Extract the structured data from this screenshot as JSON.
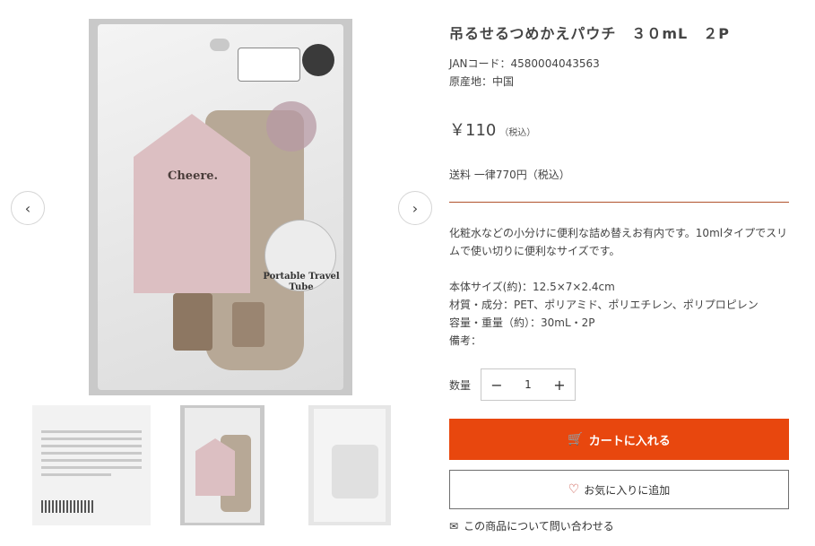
{
  "product": {
    "title": "吊るせるつめかえパウチ　３０mL　２P",
    "jan": "JANコード：4580004043563",
    "origin": "原産地：中国",
    "price": "￥110",
    "price_tax": "（税込）",
    "shipping": "送料 一律770円（税込）",
    "description": "化粧水などの小分けに便利な詰め替えお有内です。10mlタイプでスリムで使い切りに便利なサイズです。",
    "specs": [
      "本体サイズ(約)：12.5×7×2.4cm",
      "材質・成分：PET、ポリアミド、ポリエチレン、ポリプロピレン",
      "容量・重量（約）：30mL・2P",
      "備考："
    ]
  },
  "gallery": {
    "prev_icon": "chevron-left-icon",
    "next_icon": "chevron-right-icon",
    "prev_glyph": "‹",
    "next_glyph": "›",
    "package_brand": "Cheere.",
    "package_product_name": "Portable Travel Tube",
    "thumbnails": [
      "package-back",
      "package-front",
      "package-back-blank"
    ]
  },
  "purchase": {
    "quantity_label": "数量",
    "quantity_value": "1",
    "minus_glyph": "−",
    "plus_glyph": "+",
    "cart_label": "カートに入れる",
    "cart_icon": "🛒",
    "favorite_label": "お気に入りに追加",
    "favorite_icon": "♡",
    "inquiry_label": "この商品について問い合わせる",
    "inquiry_icon": "✉"
  },
  "colors": {
    "accent": "#e8470e",
    "divider": "#b0532c"
  }
}
